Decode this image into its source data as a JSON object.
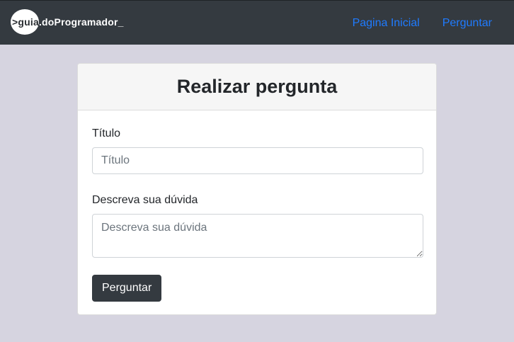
{
  "navbar": {
    "logo": {
      "prefix": ">guia",
      "rest": ".doProgramador_"
    },
    "links": [
      {
        "label": "Pagina Inicial"
      },
      {
        "label": "Perguntar"
      }
    ],
    "link_color": "#1f7bff",
    "background": "#343a40"
  },
  "page": {
    "background": "#d6d4e0"
  },
  "form": {
    "title": "Realizar pergunta",
    "title_field": {
      "label": "Título",
      "placeholder": "Título",
      "value": ""
    },
    "description_field": {
      "label": "Descreva sua dúvida",
      "placeholder": "Descreva sua dúvida",
      "value": ""
    },
    "submit_label": "Perguntar"
  }
}
